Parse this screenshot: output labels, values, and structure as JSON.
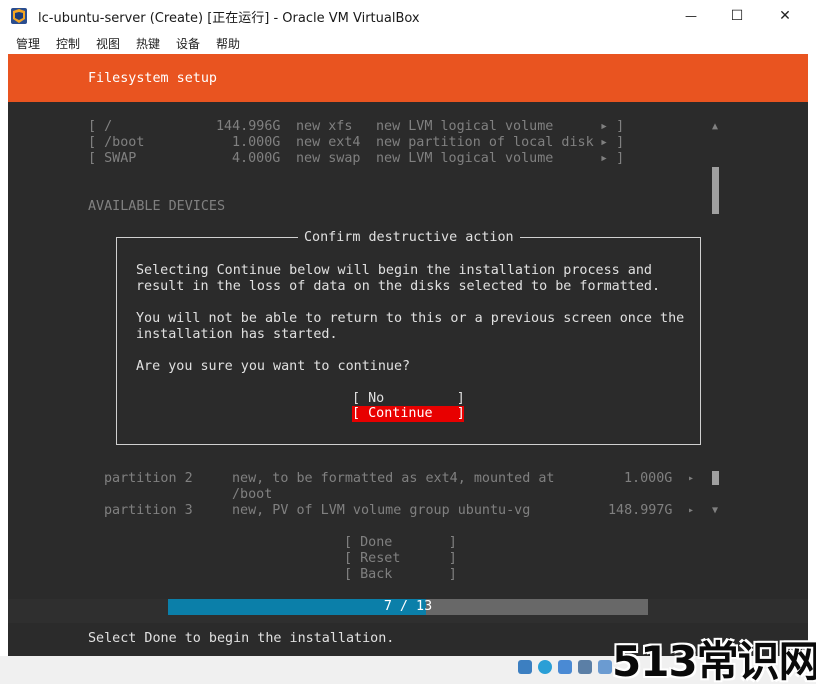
{
  "window": {
    "title": "lc-ubuntu-server (Create) [正在运行] - Oracle VM VirtualBox",
    "minimize_glyph": "—",
    "maximize_glyph": "☐",
    "close_glyph": "✕"
  },
  "menu": {
    "items": [
      "管理",
      "控制",
      "视图",
      "热键",
      "设备",
      "帮助"
    ]
  },
  "installer": {
    "header_title": "Filesystem setup",
    "fs_rows": [
      {
        "mount": "[ /",
        "size": "144.996G",
        "type": "new xfs",
        "desc": "new LVM logical volume",
        "arrow": "▸ ]"
      },
      {
        "mount": "[ /boot",
        "size": "1.000G",
        "type": "new ext4",
        "desc": "new partition of local disk",
        "arrow": "▸ ]"
      },
      {
        "mount": "[ SWAP",
        "size": "4.000G",
        "type": "new swap",
        "desc": "new LVM logical volume",
        "arrow": "▸ ]"
      }
    ],
    "available_devices_label": "AVAILABLE DEVICES",
    "partitions": [
      {
        "name": "partition 2",
        "desc": "new, to be formatted as ext4, mounted at",
        "desc2": "/boot",
        "size": "1.000G",
        "arrow": "▸"
      },
      {
        "name": "partition 3",
        "desc": "new, PV of LVM volume group ubuntu-vg",
        "size": "148.997G",
        "arrow": "▸"
      }
    ],
    "buttons": {
      "done": "[ Done       ]",
      "reset": "[ Reset      ]",
      "back": "[ Back       ]"
    },
    "progress": {
      "text": "7 / 13",
      "value": 7,
      "total": 13
    },
    "footer": "Select Done to begin the installation.",
    "scroll_up": "▲",
    "scroll_down": "▼"
  },
  "dialog": {
    "title": "Confirm destructive action",
    "line1": "Selecting Continue below will begin the installation process and",
    "line2": "result in the loss of data on the disks selected to be formatted.",
    "line3": "You will not be able to return to this or a previous screen once the",
    "line4": "installation has started.",
    "question": "Are you sure you want to continue?",
    "no_button": "[ No         ]",
    "continue_button": "[ Continue   ]"
  },
  "watermark": "513常识网",
  "colors": {
    "ubuntu_orange": "#e95420",
    "terminal_bg": "#2b2b2b",
    "selected_button": "#e80000",
    "progress_fill": "#0b7fa9"
  }
}
